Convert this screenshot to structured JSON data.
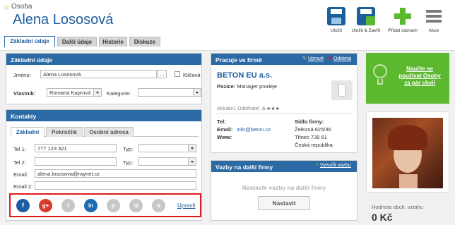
{
  "header": {
    "entity_type": "Osoba",
    "title": "Alena Lososová",
    "toolbar": {
      "save": "Uložit",
      "save_close": "Uložit & Zavřít",
      "add_record": "Přidat záznam",
      "actions": "Akce"
    }
  },
  "tabs": [
    "Základní údaje",
    "Další údaje",
    "Historie",
    "Diskuze"
  ],
  "basic": {
    "heading": "Základní údaje",
    "name_label": "Jméno:",
    "name_value": "Alena Lososová",
    "browse_label": "...",
    "key_label": "Klíčová",
    "owner_label": "Vlastník:",
    "owner_value": "Romana Kaprová",
    "category_label": "Kategorie:",
    "category_value": ""
  },
  "contacts": {
    "heading": "Kontakty",
    "subtabs": [
      "Základní",
      "Pokročilé",
      "Osobní adresa"
    ],
    "tel1_label": "Tel 1:",
    "tel1_value": "777 123 321",
    "tel2_label": "Tel 2:",
    "tel2_value": "",
    "type_label": "Typ:",
    "email_label": "Email:",
    "email_value": "alena.lososova@raynet.cz",
    "email2_label": "Email 2:",
    "email2_value": "",
    "social_icons": [
      "f",
      "g+",
      "t",
      "in",
      "p",
      "ig",
      "s"
    ],
    "edit_link": "Upravit"
  },
  "work": {
    "heading": "Pracuje ve firmě",
    "edit": "Upravit",
    "remove": "Odebrat",
    "company": "BETON EU a.s.",
    "position_label": "Pozice:",
    "position_value": "Manager prodeje",
    "updated": "Aktuální, Odběratel",
    "rating": "A ★★★",
    "tel_label": "Tel:",
    "email_label": "Email:",
    "email_value": "info@beton.cz",
    "www_label": "Www:",
    "hq_label": "Sídlo firmy:",
    "hq_street": "Železná 625/36",
    "hq_city": "Třinec 739 61",
    "hq_country": "Česká republika"
  },
  "links": {
    "heading": "Vazby na další firmy",
    "create": "Vytvořit vazbu",
    "empty": "Nastavte vazby na další firmy",
    "button": "Nastavit"
  },
  "promo": {
    "text_line1": "Naučte se",
    "text_line2": "používat Osoby",
    "text_line3": "za pár chvil"
  },
  "value": {
    "label": "Hodnota obch. vztahu",
    "amount": "0 Kč"
  },
  "colors": {
    "primary": "#2c6aa6",
    "promo": "#5cb82e",
    "highlight_box": "#e0191b"
  }
}
